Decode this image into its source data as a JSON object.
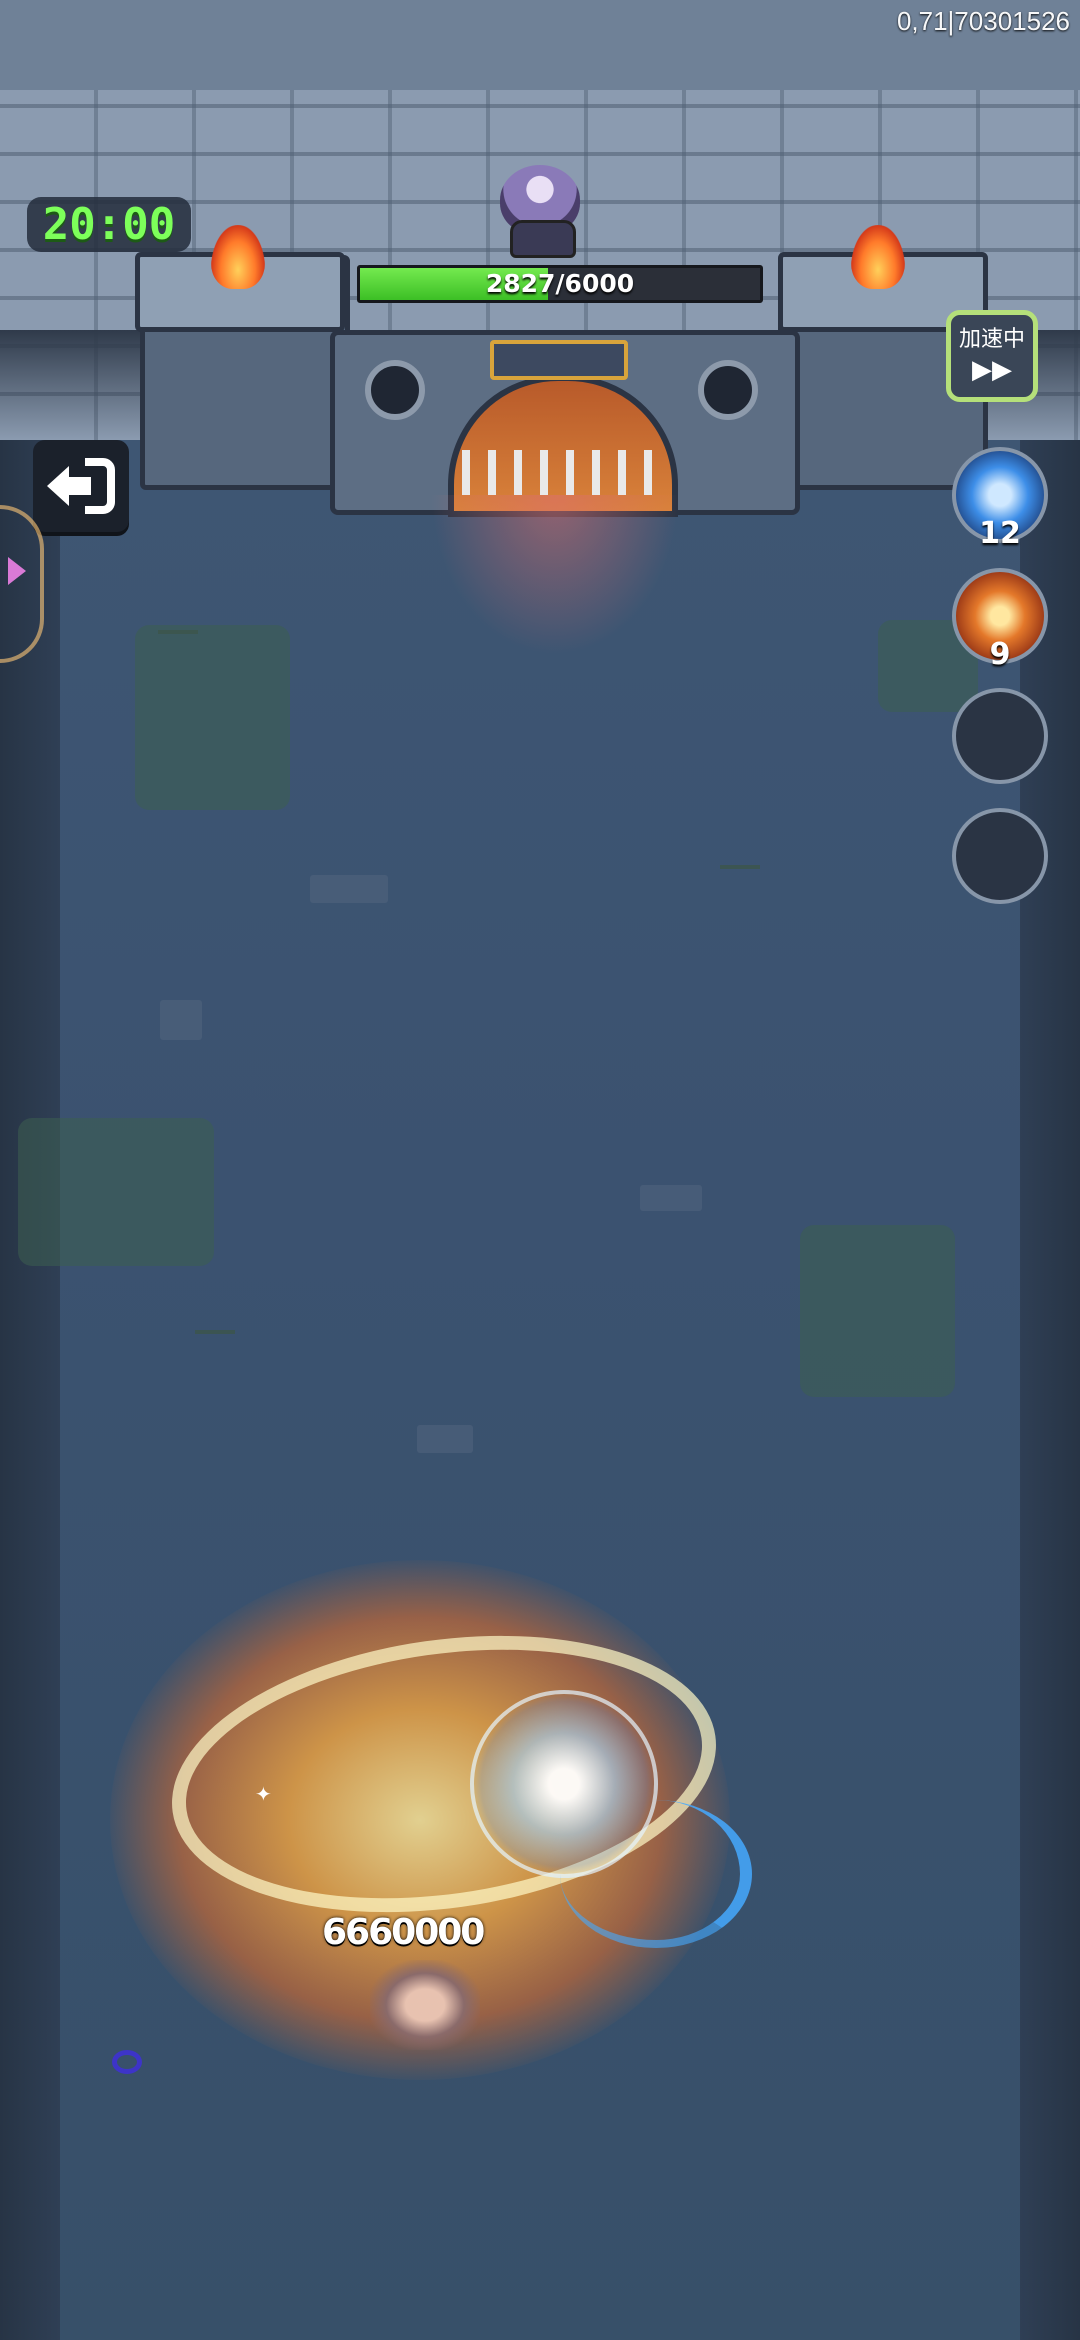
{
  "hud": {
    "timer": "20:00",
    "coords": "0,71|70301526"
  },
  "boss": {
    "hp_current": 2827,
    "hp_max": 6000,
    "hp_text": "2827/6000"
  },
  "speed_button": {
    "label": "加速中",
    "icon": "fast-forward-icon"
  },
  "back_button": {
    "icon": "exit-arrow-icon"
  },
  "side_tab": {
    "icon": "chevron-right-icon"
  },
  "skills": [
    {
      "name": "lightning-skill",
      "count": "12",
      "icon": "lightning-orb-icon"
    },
    {
      "name": "fire-ring-skill",
      "count": "9",
      "icon": "fire-ring-icon"
    },
    {
      "name": "empty-slot",
      "count": "",
      "icon": ""
    },
    {
      "name": "empty-slot",
      "count": "",
      "icon": ""
    }
  ],
  "combat": {
    "damage_text": "6660000"
  },
  "colors": {
    "timer": "#7dff5a",
    "hp_fill": "#3cbf25",
    "speed_border": "#b5e07a"
  }
}
